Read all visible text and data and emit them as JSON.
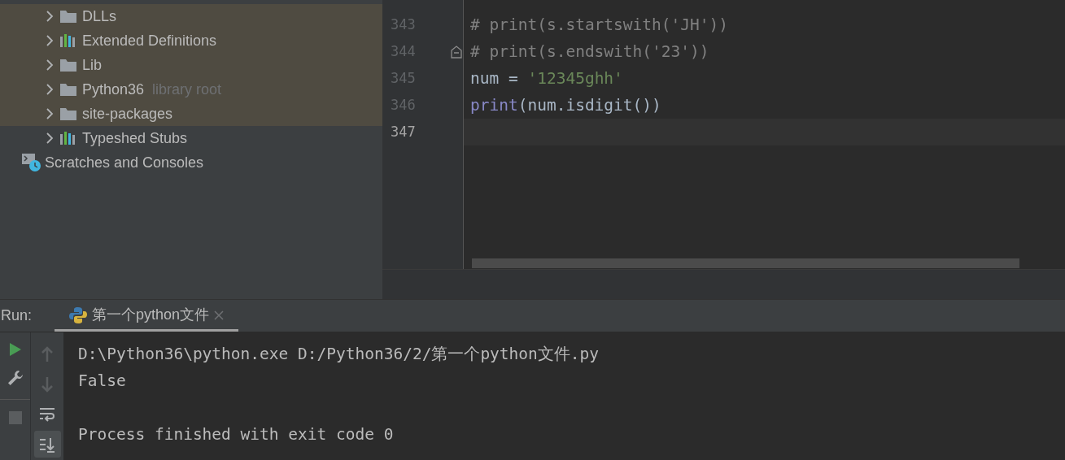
{
  "project_tree": {
    "items": [
      {
        "label": "DLLs",
        "kind": "folder",
        "highlighted": true,
        "expanded": false
      },
      {
        "label": "Extended Definitions",
        "kind": "library",
        "highlighted": true,
        "expanded": false
      },
      {
        "label": "Lib",
        "kind": "folder",
        "highlighted": true,
        "expanded": false
      },
      {
        "label": "Python36",
        "hint": "library root",
        "kind": "folder",
        "highlighted": true,
        "expanded": false
      },
      {
        "label": "site-packages",
        "kind": "folder",
        "highlighted": true,
        "expanded": false
      },
      {
        "label": "Typeshed Stubs",
        "kind": "library",
        "highlighted": false,
        "expanded": false
      }
    ],
    "scratches": {
      "label": "Scratches and Consoles"
    }
  },
  "editor": {
    "lines": [
      {
        "number": "343",
        "current": false,
        "tokens": [
          {
            "text": "# print(s.startswith('JH'))",
            "kind": "comment"
          }
        ]
      },
      {
        "number": "344",
        "current": false,
        "fold": true,
        "tokens": [
          {
            "text": "# print(s.endswith('23'))",
            "kind": "comment"
          }
        ]
      },
      {
        "number": "345",
        "current": false,
        "tokens": [
          {
            "text": "num = ",
            "kind": "plain"
          },
          {
            "text": "'12345ghh'",
            "kind": "string"
          }
        ]
      },
      {
        "number": "346",
        "current": false,
        "tokens": [
          {
            "text": "print",
            "kind": "builtin"
          },
          {
            "text": "(num.isdigit())",
            "kind": "plain"
          }
        ]
      },
      {
        "number": "347",
        "current": true
      }
    ]
  },
  "run_panel": {
    "label": "Run:",
    "tabs": [
      {
        "label": "第一个python文件",
        "selected": true
      }
    ],
    "left_toolbar": [
      {
        "kind": "play"
      },
      {
        "kind": "wrench"
      },
      {
        "kind": "stop"
      }
    ],
    "console_toolbar": [
      {
        "kind": "up",
        "selected": false
      },
      {
        "kind": "down",
        "selected": false
      },
      {
        "kind": "wrap",
        "selected": false
      },
      {
        "kind": "scroll-end",
        "selected": true
      }
    ],
    "console": [
      {
        "kind": "output",
        "text": "D:\\Python36\\python.exe D:/Python36/2/第一个python文件.py"
      },
      {
        "kind": "output",
        "text": "False"
      },
      {
        "kind": "blank"
      },
      {
        "kind": "output",
        "text": "Process finished with exit code 0"
      }
    ]
  }
}
